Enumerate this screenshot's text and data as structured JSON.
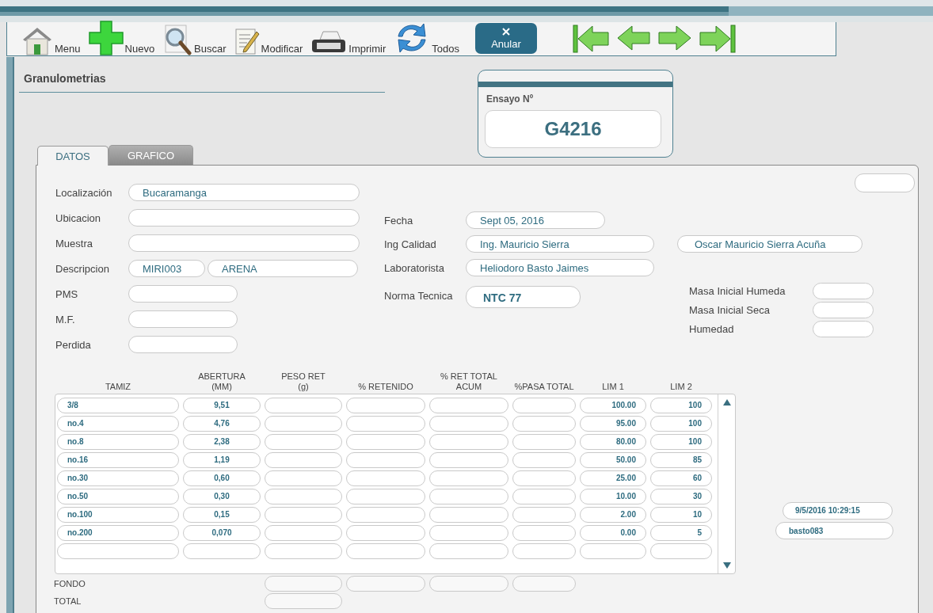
{
  "toolbar": {
    "buttons": [
      {
        "kind": "home",
        "label": "Menu"
      },
      {
        "kind": "add",
        "label": "Nuevo"
      },
      {
        "kind": "search",
        "label": "Buscar"
      },
      {
        "kind": "edit",
        "label": "Modificar"
      },
      {
        "kind": "print",
        "label": "Imprimir"
      },
      {
        "kind": "refresh",
        "label": "Todos"
      },
      {
        "kind": "cancel",
        "label": "Anular"
      }
    ],
    "nav_buttons": [
      {
        "kind": "first"
      },
      {
        "kind": "previous"
      },
      {
        "kind": "next"
      },
      {
        "kind": "last"
      }
    ]
  },
  "section_title": "Granulometrias",
  "test_number": {
    "label": "Ensayo Nº",
    "value": "G4216"
  },
  "tabs": [
    {
      "label": "DATOS",
      "selected": true
    },
    {
      "label": "GRAFICO",
      "selected": false
    }
  ],
  "left_fields": [
    {
      "label": "Localización",
      "kind": "text",
      "values": [
        "Bucaramanga"
      ]
    },
    {
      "label": "Ubicacion",
      "kind": "text"
    },
    {
      "label": "Muestra",
      "kind": "text"
    },
    {
      "label": "Descripcion",
      "kind": "split",
      "values": [
        "MIRI003",
        "ARENA"
      ]
    },
    {
      "label": "PMS",
      "kind": "short"
    },
    {
      "label": "M.F.",
      "kind": "short"
    },
    {
      "label": "Perdida",
      "kind": "short"
    }
  ],
  "right_fields": [
    {
      "label": "Fecha",
      "kind": "date",
      "value": "Sept 05, 2016"
    },
    {
      "label": "Ing Calidad",
      "kind": "name",
      "value": "Ing. Mauricio Sierra",
      "extra_value": "Oscar Mauricio Sierra Acuña"
    },
    {
      "label": "Laboratorista",
      "kind": "name",
      "value": "Heliodoro Basto Jaimes"
    },
    {
      "label": "Norma Tecnica",
      "kind": "emphasis",
      "value": "NTC 77"
    }
  ],
  "mass_fields": [
    {
      "label": "Masa Inicial Humeda"
    },
    {
      "label": "Masa Inicial Seca"
    },
    {
      "label": "Humedad"
    }
  ],
  "table": {
    "columns": [
      "TAMIZ",
      "ABERTURA\n(MM)",
      "PESO RET\n(g)",
      "% RETENIDO",
      "% RET TOTAL\nACUM",
      "%PASA TOTAL",
      "LIM 1",
      "LIM 2"
    ],
    "rows": [
      {
        "tamiz": "3/8",
        "abertura": "9,51",
        "lim_1": "100.00",
        "lim_2": "100"
      },
      {
        "tamiz": "no.4",
        "abertura": "4,76",
        "lim_1": "95.00",
        "lim_2": "100"
      },
      {
        "tamiz": "no.8",
        "abertura": "2,38",
        "lim_1": "80.00",
        "lim_2": "100"
      },
      {
        "tamiz": "no.16",
        "abertura": "1,19",
        "lim_1": "50.00",
        "lim_2": "85"
      },
      {
        "tamiz": "no.30",
        "abertura": "0,60",
        "lim_1": "25.00",
        "lim_2": "60"
      },
      {
        "tamiz": "no.50",
        "abertura": "0,30",
        "lim_1": "10.00",
        "lim_2": "30"
      },
      {
        "tamiz": "no.100",
        "abertura": "0,15",
        "lim_1": "2.00",
        "lim_2": "10"
      },
      {
        "tamiz": "no.200",
        "abertura": "0,070",
        "lim_1": "0.00",
        "lim_2": "5"
      }
    ],
    "footer": [
      {
        "label": "FONDO",
        "kind": "partials"
      },
      {
        "label": "TOTAL",
        "kind": "total"
      }
    ]
  },
  "record_info": {
    "modified": "9/5/2016 10:29:15",
    "user": "basto083"
  }
}
